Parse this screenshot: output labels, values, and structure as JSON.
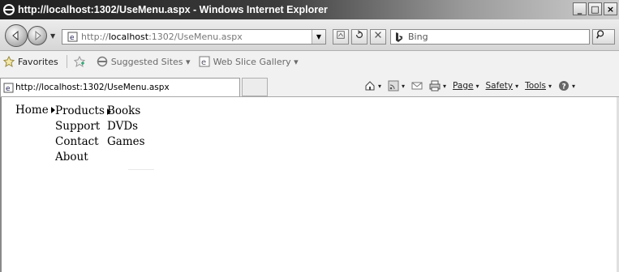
{
  "window": {
    "title": "http://localhost:1302/UseMenu.aspx - Windows Internet Explorer",
    "controls": [
      "_",
      "□",
      "×"
    ]
  },
  "address": {
    "url_prefix": "http://",
    "url_host": "localhost",
    "url_rest": ":1302/UseMenu.aspx"
  },
  "search": {
    "placeholder": "Bing"
  },
  "favorites_bar": {
    "favorites": "Favorites",
    "suggested_sites": "Suggested Sites ▾",
    "web_slice_gallery": "Web Slice Gallery ▾"
  },
  "tab": {
    "title": "http://localhost:1302/UseMenu.aspx"
  },
  "commands": {
    "page": "Page",
    "safety": "Safety",
    "tools": "Tools"
  },
  "menu": {
    "root": "Home",
    "level1": [
      "Products",
      "Support",
      "Contact",
      "About"
    ],
    "level2": [
      "Books",
      "DVDs",
      "Games"
    ]
  }
}
